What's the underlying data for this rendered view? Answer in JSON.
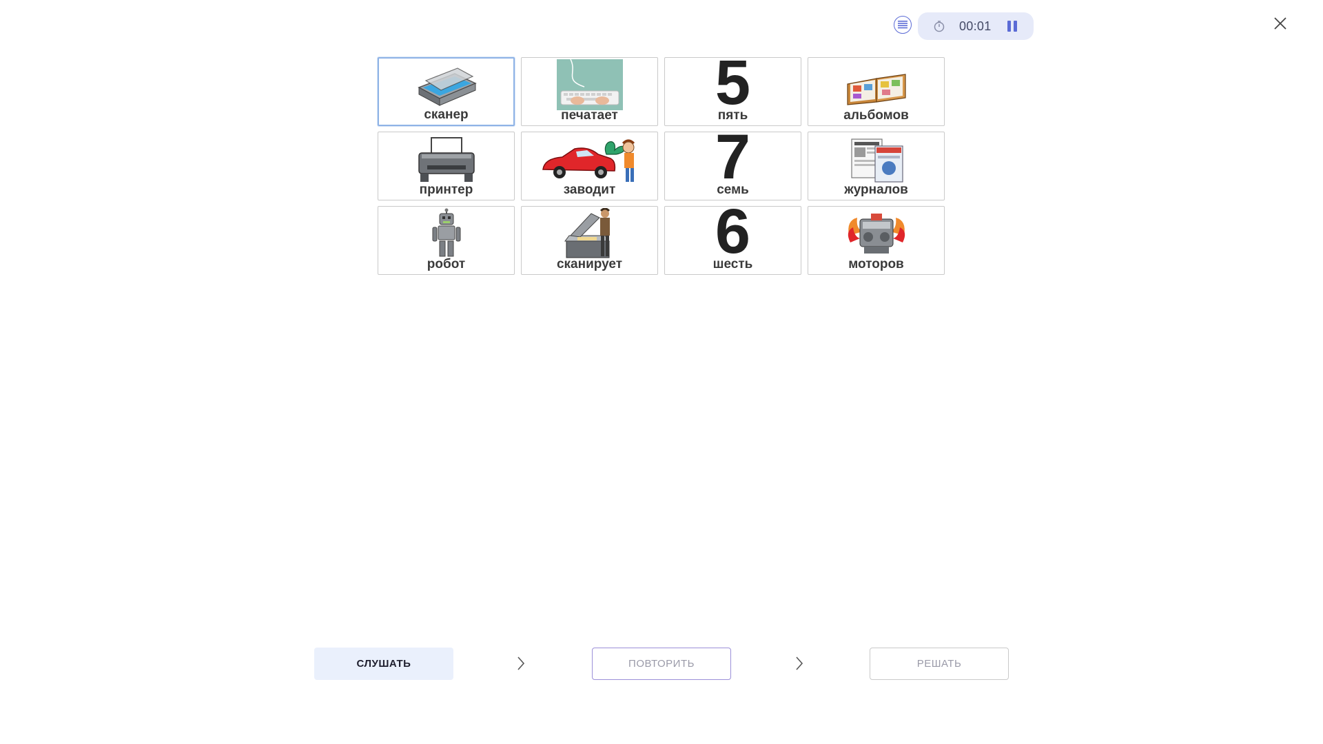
{
  "header": {
    "timer": "00:01",
    "icons": {
      "list": "list-icon",
      "timer": "stopwatch-icon",
      "pause": "pause-icon",
      "close": "close-icon"
    },
    "colors": {
      "accent": "#5b6bd6",
      "pill": "#e6eaf9"
    }
  },
  "cards": [
    {
      "label": "сканер",
      "icon": "scanner-icon",
      "selected": true
    },
    {
      "label": "печатает",
      "icon": "typing-keyboard-icon"
    },
    {
      "label": "пять",
      "icon": "digit-five-icon",
      "digit": "5"
    },
    {
      "label": "альбомов",
      "icon": "photo-albums-icon"
    },
    {
      "label": "принтер",
      "icon": "printer-icon"
    },
    {
      "label": "заводит",
      "icon": "wind-up-car-icon"
    },
    {
      "label": "семь",
      "icon": "digit-seven-icon",
      "digit": "7"
    },
    {
      "label": "журналов",
      "icon": "magazines-icon"
    },
    {
      "label": "робот",
      "icon": "robot-icon"
    },
    {
      "label": "сканирует",
      "icon": "person-scanning-icon"
    },
    {
      "label": "шесть",
      "icon": "digit-six-icon",
      "digit": "6"
    },
    {
      "label": "моторов",
      "icon": "engine-icon"
    }
  ],
  "steps": {
    "listen": "СЛУШАТЬ",
    "repeat": "ПОВТОРИТЬ",
    "solve": "РЕШАТЬ"
  }
}
